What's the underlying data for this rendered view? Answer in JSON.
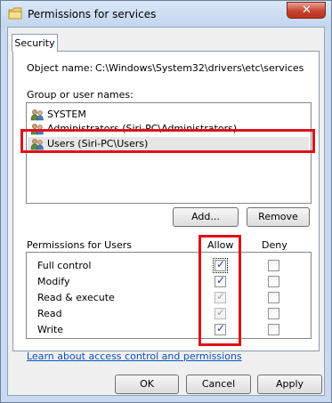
{
  "window": {
    "title": "Permissions for services",
    "close_glyph": "✕"
  },
  "tabs": [
    {
      "label": "Security"
    }
  ],
  "object": {
    "label": "Object name:",
    "value": "C:\\Windows\\System32\\drivers\\etc\\services"
  },
  "groups": {
    "label": "Group or user names:",
    "items": [
      {
        "label": "SYSTEM",
        "icon": "users-icon"
      },
      {
        "label": "Administrators (Siri-PC\\Administrators)",
        "icon": "users-icon"
      },
      {
        "label": "Users (Siri-PC\\Users)",
        "icon": "users-icon",
        "selected": true
      }
    ],
    "add_label": "Add...",
    "remove_label": "Remove"
  },
  "permissions": {
    "label": "Permissions for Users",
    "allow_header": "Allow",
    "deny_header": "Deny",
    "rows": [
      {
        "name": "Full control",
        "allow": true,
        "allow_enabled": true,
        "deny": false
      },
      {
        "name": "Modify",
        "allow": true,
        "allow_enabled": true,
        "deny": false
      },
      {
        "name": "Read & execute",
        "allow": true,
        "allow_enabled": false,
        "deny": false
      },
      {
        "name": "Read",
        "allow": true,
        "allow_enabled": false,
        "deny": false
      },
      {
        "name": "Write",
        "allow": true,
        "allow_enabled": true,
        "deny": false
      }
    ]
  },
  "link": "Learn about access control and permissions",
  "buttons": {
    "ok": "OK",
    "cancel": "Cancel",
    "apply": "Apply"
  },
  "colors": {
    "highlight": "#e01018",
    "link": "#0d52c0"
  }
}
